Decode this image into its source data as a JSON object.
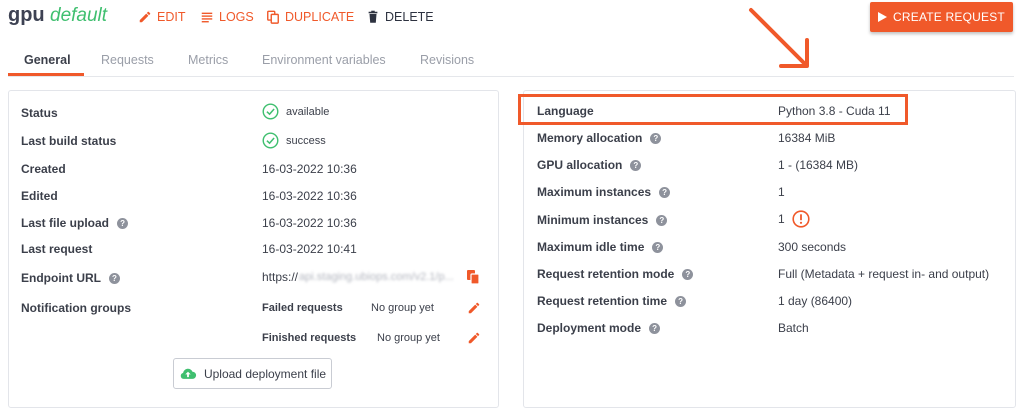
{
  "header": {
    "title": "gpu",
    "subtitle": "default",
    "edit_label": "EDIT",
    "logs_label": "LOGS",
    "duplicate_label": "DUPLICATE",
    "delete_label": "DELETE",
    "create_request_label": "CREATE REQUEST"
  },
  "tabs": [
    "General",
    "Requests",
    "Metrics",
    "Environment variables",
    "Revisions"
  ],
  "left": {
    "status_label": "Status",
    "status_value": "available",
    "last_build_label": "Last build status",
    "last_build_value": "success",
    "created_label": "Created",
    "created_value": "16-03-2022 10:36",
    "edited_label": "Edited",
    "edited_value": "16-03-2022 10:36",
    "last_upload_label": "Last file upload",
    "last_upload_value": "16-03-2022 10:36",
    "last_request_label": "Last request",
    "last_request_value": "16-03-2022 10:41",
    "endpoint_label": "Endpoint URL",
    "endpoint_prefix": "https://",
    "endpoint_blurred": "api.staging.ubiops.com/v2.1/p...",
    "notif_label": "Notification groups",
    "failed_label": "Failed requests",
    "failed_value": "No group yet",
    "finished_label": "Finished requests",
    "finished_value": "No group yet",
    "upload_label": "Upload deployment file"
  },
  "right": {
    "language_label": "Language",
    "language_value": "Python 3.8 - Cuda 11",
    "memory_label": "Memory allocation",
    "memory_value": "16384 MiB",
    "gpu_label": "GPU allocation",
    "gpu_value": "1 - (16384 MB)",
    "max_inst_label": "Maximum instances",
    "max_inst_value": "1",
    "min_inst_label": "Minimum instances",
    "min_inst_value": "1",
    "idle_label": "Maximum idle time",
    "idle_value": "300 seconds",
    "retention_mode_label": "Request retention mode",
    "retention_mode_value": "Full (Metadata + request in- and output)",
    "retention_time_label": "Request retention time",
    "retention_time_value": "1 day (86400)",
    "deploy_mode_label": "Deployment mode",
    "deploy_mode_value": "Batch"
  },
  "colors": {
    "accent": "#f0592a",
    "success": "#3fbf6f",
    "text": "#3b3f4a",
    "muted": "#9a9ea8"
  }
}
